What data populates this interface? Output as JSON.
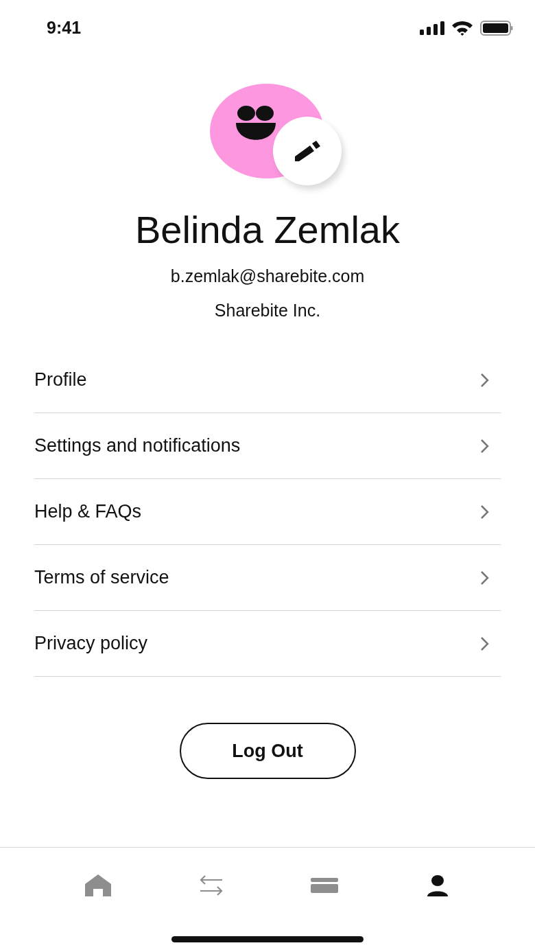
{
  "status_bar": {
    "time": "9:41"
  },
  "profile": {
    "name": "Belinda Zemlak",
    "email": "b.zemlak@sharebite.com",
    "company": "Sharebite Inc."
  },
  "menu": [
    {
      "label": "Profile"
    },
    {
      "label": "Settings and notifications"
    },
    {
      "label": "Help & FAQs"
    },
    {
      "label": "Terms of service"
    },
    {
      "label": "Privacy policy"
    }
  ],
  "logout_button": "Log Out",
  "tab_bar": [
    {
      "kind": "home",
      "selected": false
    },
    {
      "kind": "transfers",
      "selected": false
    },
    {
      "kind": "card",
      "selected": false
    },
    {
      "kind": "account",
      "selected": true
    }
  ]
}
